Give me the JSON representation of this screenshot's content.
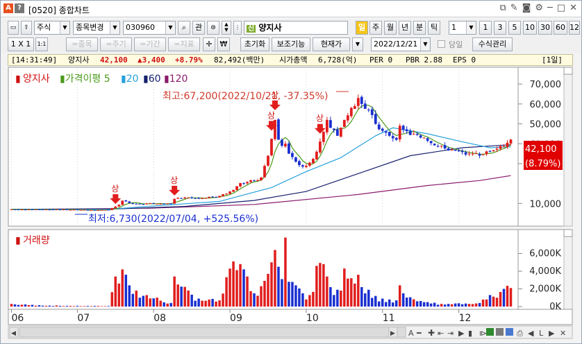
{
  "window": {
    "badge_a": "A",
    "badge_q": "?",
    "title": "[0520] 종합차트"
  },
  "toolbar1": {
    "market": "주식",
    "code_change": "종목변경",
    "code": "030960",
    "query_btn": "관",
    "sin_badge": "신",
    "stock_name": "양지사",
    "day_badge": "일",
    "periods": [
      "주",
      "월",
      "년",
      "분",
      "틱"
    ],
    "interval_value": "1",
    "intervals": [
      "1",
      "3",
      "5",
      "10",
      "30",
      "60",
      "120"
    ]
  },
  "toolbar2": {
    "ratio": "1 X 1",
    "ratio_small": "1:1",
    "disabled_buttons": [
      "=종목",
      "=주기",
      "=기간",
      "=지표"
    ],
    "won_symbol": "₩",
    "reset": "초기화",
    "assist": "보조기능",
    "current_price": "현재가",
    "date": "2022/12/21",
    "same_day": "당일",
    "formula": "수식관리"
  },
  "info": {
    "time": "[14:31:49]",
    "name": "양지사",
    "price": "42,100",
    "change": "▲3,400",
    "pct": "+8.79%",
    "volume": "82,492(백만)",
    "mktcap_label": "시가총액",
    "mktcap": "6,728(억)",
    "per": "PER 0",
    "pbr": "PBR 2.88",
    "eps": "EPS 0",
    "period": "[1일]"
  },
  "legend": {
    "name": "양지사",
    "ma_label": "가격이평 5",
    "ma20": "20",
    "ma60": "60",
    "ma120": "120"
  },
  "annotations": {
    "high": "최고:67,200(2022/10/21, -37.35%)",
    "low": "최저:6,730(2022/07/04, +525.56%)",
    "limit_up": "상",
    "current_price": "42,100",
    "current_pct": "(8.79%)"
  },
  "volume_label": "거래량",
  "colors": {
    "up": "#e11d1d",
    "down": "#1a2fd0",
    "ma5": "#4a9a1a",
    "ma20": "#27a0dc",
    "ma60": "#16206e",
    "ma120": "#8a1a6a"
  },
  "chart_data": {
    "type": "candlestick",
    "price_axis_ticks": [
      "70,000",
      "60,000",
      "50,000",
      "40,000",
      "30,000",
      "10,000"
    ],
    "price_axis_values": [
      70000,
      60000,
      50000,
      40000,
      30000,
      10000
    ],
    "ylim": [
      0,
      76000
    ],
    "volume_axis_ticks": [
      "6,000K",
      "4,000K",
      "2,000K",
      "0K"
    ],
    "volume_axis_values": [
      6000,
      4000,
      2000,
      0
    ],
    "volume_ylim": [
      0,
      8000
    ],
    "x_ticks": [
      "06",
      "07",
      "08",
      "09",
      "10",
      "11",
      "12"
    ],
    "x_tick_index": [
      0,
      19,
      41,
      63,
      85,
      107,
      129
    ],
    "n_bars": 145,
    "key_points": [
      {
        "i": 0,
        "close": 7000,
        "vol": 300
      },
      {
        "i": 8,
        "close": 6900,
        "vol": 150
      },
      {
        "i": 17,
        "close": 6800,
        "vol": 80
      },
      {
        "i": 28,
        "close": 6730,
        "vol": 60
      },
      {
        "i": 30,
        "close": 8400,
        "vol": 3400
      },
      {
        "i": 31,
        "close": 9300,
        "vol": 2600
      },
      {
        "i": 32,
        "close": 11400,
        "vol": 4200
      },
      {
        "i": 33,
        "close": 11000,
        "vol": 3600
      },
      {
        "i": 34,
        "close": 10200,
        "vol": 2400
      },
      {
        "i": 36,
        "close": 9800,
        "vol": 1800
      },
      {
        "i": 46,
        "close": 9900,
        "vol": 400
      },
      {
        "i": 47,
        "close": 12300,
        "vol": 3400
      },
      {
        "i": 48,
        "close": 12800,
        "vol": 2500
      },
      {
        "i": 54,
        "close": 12500,
        "vol": 900
      },
      {
        "i": 60,
        "close": 13800,
        "vol": 700
      },
      {
        "i": 64,
        "close": 16800,
        "vol": 5100
      },
      {
        "i": 66,
        "close": 20200,
        "vol": 4800
      },
      {
        "i": 68,
        "close": 20800,
        "vol": 3400
      },
      {
        "i": 70,
        "close": 21500,
        "vol": 1500
      },
      {
        "i": 72,
        "close": 23000,
        "vol": 2300
      },
      {
        "i": 74,
        "close": 34000,
        "vol": 3700
      },
      {
        "i": 75,
        "close": 42500,
        "vol": 5000
      },
      {
        "i": 76,
        "close": 52000,
        "vol": 6400
      },
      {
        "i": 77,
        "close": 42000,
        "vol": 4500
      },
      {
        "i": 78,
        "close": 39000,
        "vol": 3100
      },
      {
        "i": 79,
        "close": 40000,
        "vol": 7800
      },
      {
        "i": 80,
        "close": 35000,
        "vol": 2800
      },
      {
        "i": 82,
        "close": 31000,
        "vol": 2400
      },
      {
        "i": 84,
        "close": 28500,
        "vol": 1500
      },
      {
        "i": 86,
        "close": 30500,
        "vol": 1300
      },
      {
        "i": 88,
        "close": 36000,
        "vol": 4600
      },
      {
        "i": 90,
        "close": 46000,
        "vol": 4800
      },
      {
        "i": 91,
        "close": 52000,
        "vol": 3400
      },
      {
        "i": 92,
        "close": 48000,
        "vol": 2200
      },
      {
        "i": 94,
        "close": 44000,
        "vol": 1900
      },
      {
        "i": 96,
        "close": 52000,
        "vol": 4300
      },
      {
        "i": 98,
        "close": 58000,
        "vol": 3200
      },
      {
        "i": 100,
        "close": 63000,
        "vol": 3600
      },
      {
        "i": 101,
        "close": 60000,
        "vol": 2200
      },
      {
        "i": 103,
        "close": 57000,
        "vol": 1900
      },
      {
        "i": 105,
        "close": 50000,
        "vol": 1200
      },
      {
        "i": 107,
        "close": 46500,
        "vol": 900
      },
      {
        "i": 109,
        "close": 44000,
        "vol": 800
      },
      {
        "i": 111,
        "close": 42000,
        "vol": 700
      },
      {
        "i": 112,
        "close": 49000,
        "vol": 2400
      },
      {
        "i": 113,
        "close": 47000,
        "vol": 1500
      },
      {
        "i": 117,
        "close": 44500,
        "vol": 600
      },
      {
        "i": 120,
        "close": 41500,
        "vol": 500
      },
      {
        "i": 124,
        "close": 39000,
        "vol": 300
      },
      {
        "i": 128,
        "close": 36500,
        "vol": 350
      },
      {
        "i": 132,
        "close": 35000,
        "vol": 300
      },
      {
        "i": 135,
        "close": 34000,
        "vol": 400
      },
      {
        "i": 138,
        "close": 36000,
        "vol": 1300
      },
      {
        "i": 140,
        "close": 37500,
        "vol": 1000
      },
      {
        "i": 142,
        "close": 38700,
        "vol": 2000
      },
      {
        "i": 144,
        "close": 42100,
        "vol": 2100
      }
    ],
    "ma20_points": [
      [
        0,
        7000
      ],
      [
        28,
        7000
      ],
      [
        40,
        8600
      ],
      [
        60,
        11000
      ],
      [
        75,
        18000
      ],
      [
        85,
        26000
      ],
      [
        95,
        33000
      ],
      [
        105,
        44000
      ],
      [
        110,
        48000
      ],
      [
        120,
        45000
      ],
      [
        130,
        41000
      ],
      [
        138,
        38000
      ],
      [
        144,
        38500
      ]
    ],
    "ma60_points": [
      [
        0,
        7000
      ],
      [
        30,
        7200
      ],
      [
        50,
        8500
      ],
      [
        70,
        11500
      ],
      [
        85,
        16000
      ],
      [
        100,
        25000
      ],
      [
        115,
        34000
      ],
      [
        130,
        38000
      ],
      [
        144,
        39500
      ]
    ],
    "ma120_points": [
      [
        0,
        7000
      ],
      [
        40,
        7600
      ],
      [
        70,
        9500
      ],
      [
        100,
        14500
      ],
      [
        120,
        19000
      ],
      [
        135,
        21500
      ],
      [
        144,
        24000
      ]
    ],
    "limit_up_markers": [
      30,
      47,
      75,
      76,
      89
    ],
    "high_point": {
      "i": 100,
      "value": 67200
    },
    "low_point": {
      "i": 28,
      "value": 6730
    }
  }
}
